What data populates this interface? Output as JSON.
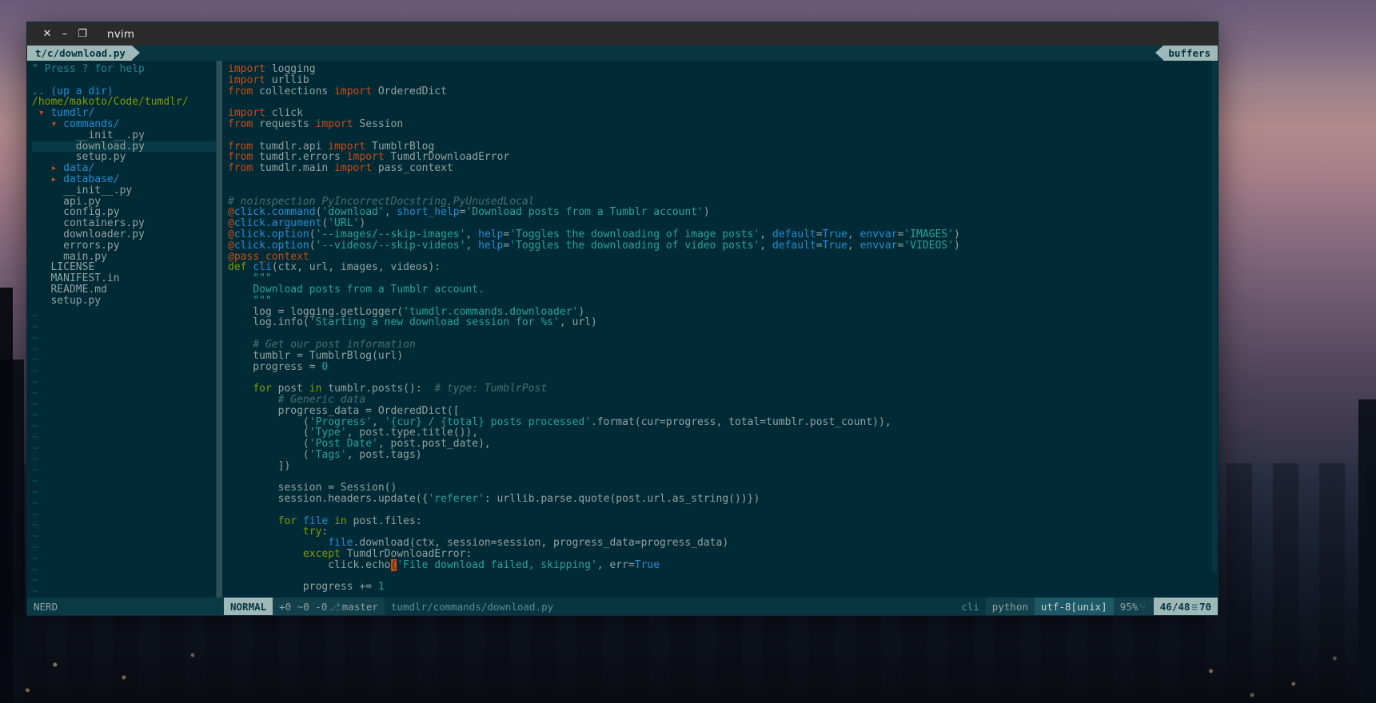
{
  "window": {
    "title": "nvim",
    "close_label": "✕",
    "minimize_label": "–",
    "maximize_label": "❐"
  },
  "tabline": {
    "tab_label": "t/c/download.py",
    "buffers_label": "buffers"
  },
  "nerdtree": {
    "help_line": "\" Press ? for help",
    "up_a_dir": ".. (up a dir)",
    "cwd": "/home/makoto/Code/tumdlr/",
    "items": [
      {
        "indent": 0,
        "arrow": "▾",
        "label": "tumdlr/",
        "type": "dir",
        "selected": false
      },
      {
        "indent": 1,
        "arrow": "▾",
        "label": "commands/",
        "type": "dir",
        "selected": false
      },
      {
        "indent": 2,
        "arrow": "",
        "label": "__init__.py",
        "type": "file",
        "selected": false
      },
      {
        "indent": 2,
        "arrow": "",
        "label": "download.py",
        "type": "file",
        "selected": true
      },
      {
        "indent": 2,
        "arrow": "",
        "label": "setup.py",
        "type": "file",
        "selected": false
      },
      {
        "indent": 1,
        "arrow": "▸",
        "label": "data/",
        "type": "dir",
        "selected": false
      },
      {
        "indent": 1,
        "arrow": "▸",
        "label": "database/",
        "type": "dir",
        "selected": false
      },
      {
        "indent": 1,
        "arrow": "",
        "label": "__init__.py",
        "type": "file",
        "selected": false
      },
      {
        "indent": 1,
        "arrow": "",
        "label": "api.py",
        "type": "file",
        "selected": false
      },
      {
        "indent": 1,
        "arrow": "",
        "label": "config.py",
        "type": "file",
        "selected": false
      },
      {
        "indent": 1,
        "arrow": "",
        "label": "containers.py",
        "type": "file",
        "selected": false
      },
      {
        "indent": 1,
        "arrow": "",
        "label": "downloader.py",
        "type": "file",
        "selected": false
      },
      {
        "indent": 1,
        "arrow": "",
        "label": "errors.py",
        "type": "file",
        "selected": false
      },
      {
        "indent": 1,
        "arrow": "",
        "label": "main.py",
        "type": "file",
        "selected": false
      },
      {
        "indent": 0,
        "arrow": "",
        "label": "LICENSE",
        "type": "file",
        "selected": false
      },
      {
        "indent": 0,
        "arrow": "",
        "label": "MANIFEST.in",
        "type": "file",
        "selected": false
      },
      {
        "indent": 0,
        "arrow": "",
        "label": "README.md",
        "type": "file",
        "selected": false
      },
      {
        "indent": 0,
        "arrow": "",
        "label": "setup.py",
        "type": "file",
        "selected": false
      }
    ],
    "empty_marker": "~"
  },
  "code": {
    "lines": [
      [
        [
          "kw2",
          "import "
        ],
        [
          "id",
          "logging"
        ]
      ],
      [
        [
          "kw2",
          "import "
        ],
        [
          "id",
          "urllib"
        ]
      ],
      [
        [
          "kw2",
          "from "
        ],
        [
          "id",
          "collections "
        ],
        [
          "kw2",
          "import "
        ],
        [
          "id",
          "OrderedDict"
        ]
      ],
      [],
      [
        [
          "kw2",
          "import "
        ],
        [
          "id",
          "click"
        ]
      ],
      [
        [
          "kw2",
          "from "
        ],
        [
          "id",
          "requests "
        ],
        [
          "kw2",
          "import "
        ],
        [
          "id",
          "Session"
        ]
      ],
      [],
      [
        [
          "kw2",
          "from "
        ],
        [
          "id",
          "tumdlr.api "
        ],
        [
          "kw2",
          "import "
        ],
        [
          "id",
          "TumblrBlog"
        ]
      ],
      [
        [
          "kw2",
          "from "
        ],
        [
          "id",
          "tumdlr.errors "
        ],
        [
          "kw2",
          "import "
        ],
        [
          "id",
          "TumdlrDownloadError"
        ]
      ],
      [
        [
          "kw2",
          "from "
        ],
        [
          "id",
          "tumdlr.main "
        ],
        [
          "kw2",
          "import "
        ],
        [
          "id",
          "pass_context"
        ]
      ],
      [],
      [],
      [
        [
          "cmt",
          "# noinspection PyIncorrectDocstring,PyUnusedLocal"
        ]
      ],
      [
        [
          "dec",
          "@"
        ],
        [
          "fn",
          "click.command"
        ],
        [
          "id",
          "("
        ],
        [
          "str",
          "'download'"
        ],
        [
          "id",
          ", "
        ],
        [
          "fn",
          "short_help"
        ],
        [
          "id",
          "="
        ],
        [
          "str",
          "'Download posts from a Tumblr account'"
        ],
        [
          "id",
          ")"
        ]
      ],
      [
        [
          "dec",
          "@"
        ],
        [
          "fn",
          "click.argument"
        ],
        [
          "id",
          "("
        ],
        [
          "str",
          "'URL'"
        ],
        [
          "id",
          ")"
        ]
      ],
      [
        [
          "dec",
          "@"
        ],
        [
          "fn",
          "click.option"
        ],
        [
          "id",
          "("
        ],
        [
          "str",
          "'--images/--skip-images'"
        ],
        [
          "id",
          ", "
        ],
        [
          "fn",
          "help"
        ],
        [
          "id",
          "="
        ],
        [
          "str",
          "'Toggles the downloading of image posts'"
        ],
        [
          "id",
          ", "
        ],
        [
          "fn",
          "default"
        ],
        [
          "id",
          "="
        ],
        [
          "bool",
          "True"
        ],
        [
          "id",
          ", "
        ],
        [
          "fn",
          "envvar"
        ],
        [
          "id",
          "="
        ],
        [
          "str",
          "'IMAGES'"
        ],
        [
          "id",
          ")"
        ]
      ],
      [
        [
          "dec",
          "@"
        ],
        [
          "fn",
          "click.option"
        ],
        [
          "id",
          "("
        ],
        [
          "str",
          "'--videos/--skip-videos'"
        ],
        [
          "id",
          ", "
        ],
        [
          "fn",
          "help"
        ],
        [
          "id",
          "="
        ],
        [
          "str",
          "'Toggles the downloading of video posts'"
        ],
        [
          "id",
          ", "
        ],
        [
          "fn",
          "default"
        ],
        [
          "id",
          "="
        ],
        [
          "bool",
          "True"
        ],
        [
          "id",
          ", "
        ],
        [
          "fn",
          "envvar"
        ],
        [
          "id",
          "="
        ],
        [
          "str",
          "'VIDEOS'"
        ],
        [
          "id",
          ")"
        ]
      ],
      [
        [
          "dec",
          "@"
        ],
        [
          "dec",
          "pass_context"
        ]
      ],
      [
        [
          "k",
          "def "
        ],
        [
          "fn",
          "cli"
        ],
        [
          "id",
          "(ctx, url, images, videos):"
        ]
      ],
      [
        [
          "id",
          "    "
        ],
        [
          "str",
          "\"\"\""
        ]
      ],
      [
        [
          "id",
          "    "
        ],
        [
          "str",
          "Download posts from a Tumblr account."
        ]
      ],
      [
        [
          "id",
          "    "
        ],
        [
          "str",
          "\"\"\""
        ]
      ],
      [
        [
          "id",
          "    log = logging.getLogger("
        ],
        [
          "str",
          "'tumdlr.commands.downloader'"
        ],
        [
          "id",
          ")"
        ]
      ],
      [
        [
          "id",
          "    log.info("
        ],
        [
          "str",
          "'Starting a new download session for %s'"
        ],
        [
          "id",
          ", url)"
        ]
      ],
      [],
      [
        [
          "id",
          "    "
        ],
        [
          "cmt",
          "# Get our post information"
        ]
      ],
      [
        [
          "id",
          "    tumblr = TumblrBlog(url)"
        ]
      ],
      [
        [
          "id",
          "    progress = "
        ],
        [
          "num",
          "0"
        ]
      ],
      [],
      [
        [
          "id",
          "    "
        ],
        [
          "k",
          "for "
        ],
        [
          "id",
          "post "
        ],
        [
          "k",
          "in "
        ],
        [
          "id",
          "tumblr.posts():  "
        ],
        [
          "cmt",
          "# type: TumblrPost"
        ]
      ],
      [
        [
          "id",
          "        "
        ],
        [
          "cmt",
          "# Generic data"
        ]
      ],
      [
        [
          "id",
          "        progress_data = OrderedDict(["
        ]
      ],
      [
        [
          "id",
          "            ("
        ],
        [
          "str",
          "'Progress'"
        ],
        [
          "id",
          ", "
        ],
        [
          "str",
          "'{cur} / {total} posts processed'"
        ],
        [
          "id",
          ".format(cur=progress, total=tumblr.post_count)),"
        ]
      ],
      [
        [
          "id",
          "            ("
        ],
        [
          "str",
          "'Type'"
        ],
        [
          "id",
          ", post.type.title()),"
        ]
      ],
      [
        [
          "id",
          "            ("
        ],
        [
          "str",
          "'Post Date'"
        ],
        [
          "id",
          ", post.post_date),"
        ]
      ],
      [
        [
          "id",
          "            ("
        ],
        [
          "str",
          "'Tags'"
        ],
        [
          "id",
          ", post.tags)"
        ]
      ],
      [
        [
          "id",
          "        ])"
        ]
      ],
      [],
      [
        [
          "id",
          "        session = Session()"
        ]
      ],
      [
        [
          "id",
          "        session.headers.update({"
        ],
        [
          "str",
          "'referer'"
        ],
        [
          "id",
          ": urllib.parse.quote(post.url.as_string())})"
        ]
      ],
      [],
      [
        [
          "id",
          "        "
        ],
        [
          "k",
          "for "
        ],
        [
          "fn",
          "file "
        ],
        [
          "k",
          "in "
        ],
        [
          "id",
          "post.files:"
        ]
      ],
      [
        [
          "id",
          "            "
        ],
        [
          "k",
          "try"
        ],
        [
          "id",
          ":"
        ]
      ],
      [
        [
          "id",
          "                "
        ],
        [
          "fn",
          "file"
        ],
        [
          "id",
          ".download(ctx, session=session, progress_data=progress_data)"
        ]
      ],
      [
        [
          "id",
          "            "
        ],
        [
          "k",
          "except "
        ],
        [
          "id",
          "TumdlrDownloadError:"
        ]
      ],
      [
        [
          "id",
          "                click.echo"
        ],
        [
          "cursor",
          "("
        ],
        [
          "str",
          "'File download failed, skipping'"
        ],
        [
          "id",
          ", err="
        ],
        [
          "bool",
          "True"
        ],
        [
          "cursorblk",
          ""
        ]
      ],
      [],
      [
        [
          "id",
          "            progress += "
        ],
        [
          "num",
          "1"
        ]
      ]
    ]
  },
  "statusline": {
    "nerdtree_label": "NERD",
    "mode": "NORMAL",
    "git_stats": "+0 ~0 -0",
    "branch_icon": "⎇",
    "branch": "master",
    "file_path": "tumdlr/commands/download.py",
    "cli_label": "cli",
    "filetype": "python",
    "encoding": "utf-8[unix]",
    "percent": "95%",
    "line_icon": "⑂",
    "position": "46/48",
    "col_icon": "≡",
    "column": "70"
  },
  "colors": {
    "background": "#002b36",
    "foreground": "#93a1a1",
    "keyword": "#859900",
    "import_keyword": "#cb4b16",
    "string": "#2aa198",
    "comment": "#4f6b70",
    "function": "#268bd2",
    "accent": "#9fb8b8",
    "cursor": "#cb4b16"
  }
}
